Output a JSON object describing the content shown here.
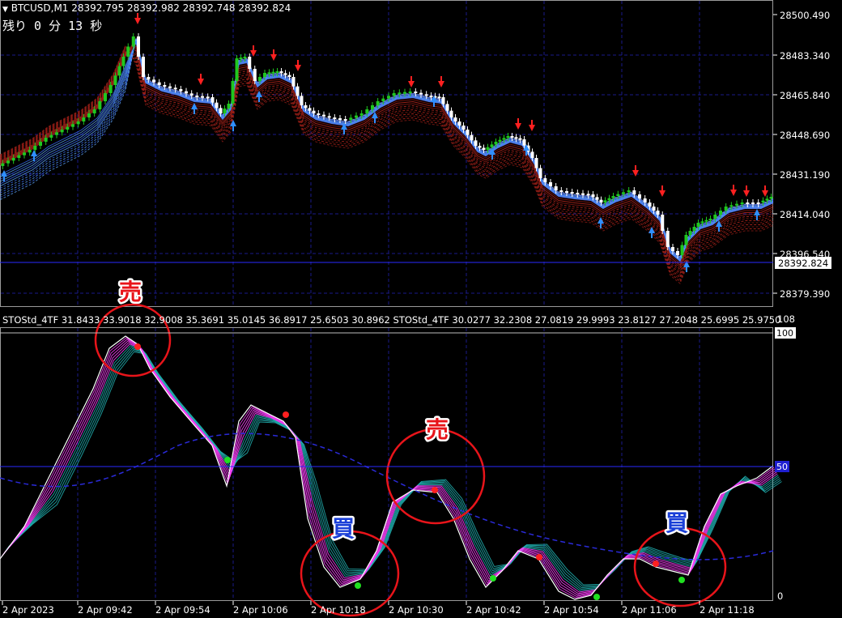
{
  "main_panel": {
    "symbol_line": "BTCUSD,M1  28392.795 28392.982 28392.748 28392.824",
    "timer": "残り 0 分 13 秒",
    "price_ticks": [
      "28500.490",
      "28483.340",
      "28465.840",
      "28448.690",
      "28431.190",
      "28414.040",
      "28396.540",
      "28379.390"
    ],
    "current_price": "28392.824"
  },
  "sub_panel": {
    "indicator_line": "STOStd_4TF 31.8433 33.9018 32.9008 35.3691 35.0145 36.8917 25.6503 30.8962  STOStd_4TF 30.0277 32.2308 27.0819 29.9993 23.8127 27.2048 25.6995 25.9750",
    "max_label": "108",
    "level_100": "100",
    "level_50": "50",
    "level_0": "0"
  },
  "time_axis": [
    "2 Apr 2023",
    "2 Apr 09:42",
    "2 Apr 09:54",
    "2 Apr 10:06",
    "2 Apr 10:18",
    "2 Apr 10:30",
    "2 Apr 10:42",
    "2 Apr 10:54",
    "2 Apr 11:06",
    "2 Apr 11:18"
  ],
  "annotations": [
    {
      "text": "売",
      "color": "#e8141a"
    },
    {
      "text": "売",
      "color": "#e8141a"
    },
    {
      "text": "買",
      "color": "#1a3fd8"
    },
    {
      "text": "買",
      "color": "#1a3fd8"
    }
  ],
  "colors": {
    "bull_candle": "#1fc71f",
    "bear_candle": "#ffffff",
    "sell_arrow": "#ff2020",
    "buy_arrow": "#2f8fff",
    "grid": "#1a1a8a",
    "stoch_main": "#ffffff",
    "stoch_fan_a": "#ff40ff",
    "stoch_fan_b": "#20b0b0",
    "level_line": "#1f1fd0"
  }
}
